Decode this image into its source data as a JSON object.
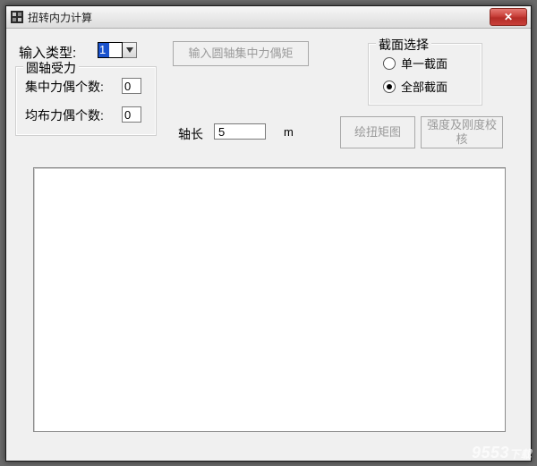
{
  "window": {
    "title": "扭转内力计算",
    "close_label": "✕"
  },
  "input_type": {
    "label": "输入类型:",
    "value": "1"
  },
  "shaft_group": {
    "legend": "圆轴受力",
    "concentrated_label": "集中力偶个数:",
    "concentrated_value": "0",
    "distributed_label": "均布力偶个数:",
    "distributed_value": "0"
  },
  "buttons": {
    "input_torque": "输入圆轴集中力偶矩",
    "draw_diagram": "绘扭矩图",
    "strength_check": "强度及刚度校核"
  },
  "section_group": {
    "legend": "截面选择",
    "single": "单一截面",
    "all": "全部截面",
    "selected": "all"
  },
  "shaft_length": {
    "label": "轴长",
    "value": "5",
    "unit": "m"
  },
  "watermark": {
    "main": "9553",
    "suffix": "下载"
  }
}
